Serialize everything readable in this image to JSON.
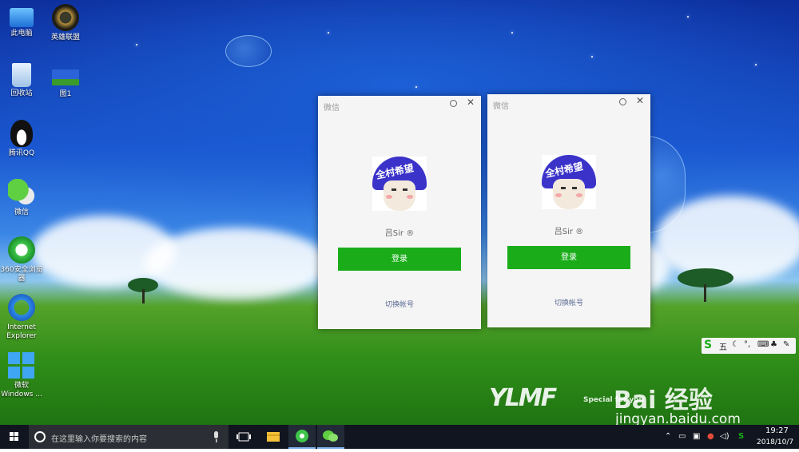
{
  "desktop": {
    "icons": [
      {
        "label": "此电脑",
        "icon": "computer-icon"
      },
      {
        "label": "英雄联盟",
        "icon": "league-of-legends-icon"
      },
      {
        "label": "回收站",
        "icon": "recycle-bin-icon"
      },
      {
        "label": "图1",
        "icon": "image-file-icon"
      },
      {
        "label": "腾讯QQ",
        "icon": "qq-penguin-icon"
      },
      {
        "label": "微信",
        "icon": "wechat-icon"
      },
      {
        "label": "360安全浏览器",
        "icon": "360-browser-icon"
      },
      {
        "label": "Internet Explorer",
        "icon": "internet-explorer-icon"
      },
      {
        "label": "微软 Windows ...",
        "icon": "windows-logo-icon"
      }
    ]
  },
  "wechat_windows": [
    {
      "title": "微信",
      "avatar_text": "全村希望",
      "username": "吕Sir",
      "login_button": "登录",
      "switch_account": "切换帐号"
    },
    {
      "title": "微信",
      "avatar_text": "全村希望",
      "username": "吕Sir",
      "login_button": "登录",
      "switch_account": "切换帐号"
    }
  ],
  "ime_toolbar": {
    "mode_label": "五",
    "icons": [
      "sogou-s-icon",
      "moon-icon",
      "punctuation-icon",
      "keyboard-icon",
      "shirt-icon",
      "wrench-icon"
    ]
  },
  "watermarks": {
    "brand": "YLMF",
    "brand_sub": "Special for you",
    "baidu": "Bai 经验",
    "url": "jingyan.baidu.com"
  },
  "taskbar": {
    "search_placeholder": "在这里输入你要搜索的内容",
    "apps": [
      "task-view-icon",
      "file-explorer-icon",
      "360-browser-icon",
      "wechat-icon"
    ],
    "clock_time": "19:27",
    "clock_date": "2018/10/7"
  },
  "colors": {
    "wechat_green": "#1aad19",
    "taskbar": "#10151f",
    "window_bg": "#f5f5f5"
  }
}
